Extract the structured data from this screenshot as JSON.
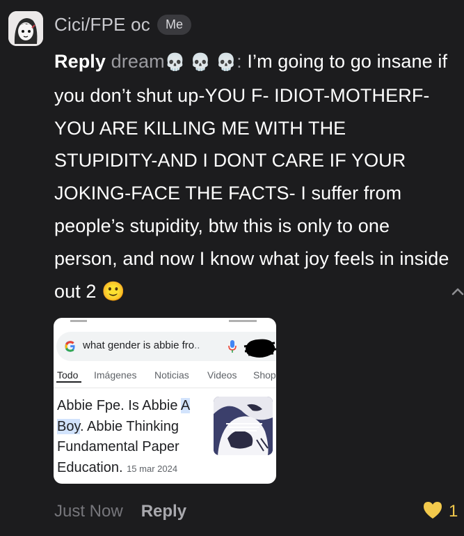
{
  "comment": {
    "author": "Cici/FPE oc",
    "me_badge": "Me",
    "reply_label": "Reply",
    "reply_target": "dream",
    "reply_skulls": "💀 💀 💀",
    "colon": ":",
    "text": "I’m going to go insane if you don’t shut up-YOU F- IDIOT-MOTHERF-YOU ARE KILLING ME WITH THE STUPIDITY-AND I DONT CARE IF YOUR JOKING-FACE THE FACTS- I suffer from people’s stupidity, btw this is only to one person, and now I know what joy feels in inside out 2",
    "trailing_emoji": "🙂"
  },
  "attached_screenshot": {
    "search_query": "what gender is abbie fro",
    "search_query_ellipsis": "..",
    "tabs": [
      "Todo",
      "Imágenes",
      "Noticias",
      "Videos",
      "Shop"
    ],
    "result_title_part1": "Abbie Fpe. Is Abbie ",
    "result_title_highlight": "A Boy",
    "result_title_part2": ". Abbie Thinking Fundamental Paper Education.",
    "result_date": "15 mar 2024",
    "icons": [
      "google-g-icon",
      "microphone-icon",
      "redaction-scribble",
      "result-thumbnail-image"
    ]
  },
  "footer": {
    "timestamp": "Just Now",
    "reply_button": "Reply",
    "like_count": "1",
    "like_icon": "heart-icon"
  },
  "colors": {
    "background": "#1c1c1e",
    "text": "#ffffff",
    "muted": "#76767b",
    "like": "#f2c94c",
    "search_highlight": "#d2e3fc"
  }
}
